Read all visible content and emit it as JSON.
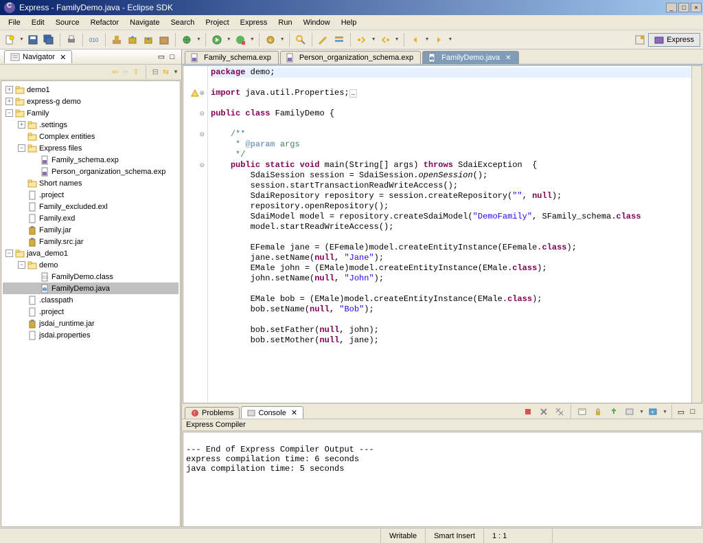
{
  "window": {
    "title": "Express - FamilyDemo.java - Eclipse SDK"
  },
  "menu": {
    "file": "File",
    "edit": "Edit",
    "source": "Source",
    "refactor": "Refactor",
    "navigate": "Navigate",
    "search": "Search",
    "project": "Project",
    "express": "Express",
    "run": "Run",
    "window": "Window",
    "help": "Help"
  },
  "perspective": {
    "label": "Express"
  },
  "navigator": {
    "title": "Navigator",
    "tree": [
      {
        "d": 0,
        "e": "+",
        "i": "proj",
        "t": "demo1"
      },
      {
        "d": 0,
        "e": "+",
        "i": "folder",
        "t": "express-g demo"
      },
      {
        "d": 0,
        "e": "-",
        "i": "folder",
        "t": "Family"
      },
      {
        "d": 1,
        "e": "+",
        "i": "folder",
        "t": ".settings"
      },
      {
        "d": 1,
        "e": "",
        "i": "folder",
        "t": "Complex entities"
      },
      {
        "d": 1,
        "e": "-",
        "i": "folder",
        "t": "Express files"
      },
      {
        "d": 2,
        "e": "",
        "i": "exp",
        "t": "Family_schema.exp"
      },
      {
        "d": 2,
        "e": "",
        "i": "exp",
        "t": "Person_organization_schema.exp"
      },
      {
        "d": 1,
        "e": "",
        "i": "folder",
        "t": "Short names"
      },
      {
        "d": 1,
        "e": "",
        "i": "file",
        "t": ".project"
      },
      {
        "d": 1,
        "e": "",
        "i": "file",
        "t": "Family_excluded.exl"
      },
      {
        "d": 1,
        "e": "",
        "i": "file",
        "t": "Family.exd"
      },
      {
        "d": 1,
        "e": "",
        "i": "jar",
        "t": "Family.jar"
      },
      {
        "d": 1,
        "e": "",
        "i": "jar",
        "t": "Family.src.jar"
      },
      {
        "d": 0,
        "e": "-",
        "i": "proj",
        "t": "java_demo1"
      },
      {
        "d": 1,
        "e": "-",
        "i": "folder",
        "t": "demo"
      },
      {
        "d": 2,
        "e": "",
        "i": "class",
        "t": "FamilyDemo.class"
      },
      {
        "d": 2,
        "e": "",
        "i": "java",
        "t": "FamilyDemo.java",
        "sel": true
      },
      {
        "d": 1,
        "e": "",
        "i": "file",
        "t": ".classpath"
      },
      {
        "d": 1,
        "e": "",
        "i": "file",
        "t": ".project"
      },
      {
        "d": 1,
        "e": "",
        "i": "jar",
        "t": "jsdai_runtime.jar"
      },
      {
        "d": 1,
        "e": "",
        "i": "file",
        "t": "jsdai.properties"
      }
    ]
  },
  "editor": {
    "tabs": [
      {
        "label": "Family_schema.exp",
        "icon": "exp",
        "active": false
      },
      {
        "label": "Person_organization_schema.exp",
        "icon": "exp",
        "active": false
      },
      {
        "label": "FamilyDemo.java",
        "icon": "java",
        "active": true,
        "close": true
      }
    ]
  },
  "bottom": {
    "tabs": {
      "problems": "Problems",
      "console": "Console"
    },
    "console_title": "Express Compiler",
    "console_text": "\n--- End of Express Compiler Output ---\nexpress compilation time: 6 seconds\njava compilation time: 5 seconds\n"
  },
  "status": {
    "writable": "Writable",
    "insert": "Smart Insert",
    "pos": "1 : 1"
  }
}
